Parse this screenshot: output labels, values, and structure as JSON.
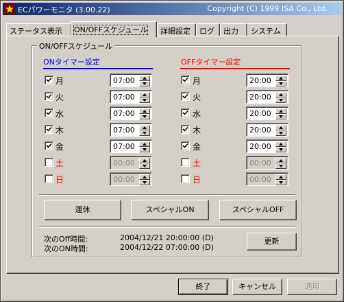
{
  "window": {
    "title": "ECパワーモニタ (3.00.22)",
    "copyright": "Copyright (C) 1999 ISA Co., Ltd."
  },
  "tabs": [
    {
      "label": "ステータス表示"
    },
    {
      "label": "ON/OFFスケジュール"
    },
    {
      "label": "詳細設定"
    },
    {
      "label": "ログ"
    },
    {
      "label": "出力"
    },
    {
      "label": "システム"
    }
  ],
  "schedule": {
    "group_title": "ON/OFFスケジュール",
    "on_header": "ONタイマー設定",
    "off_header": "OFFタイマー設定",
    "days": [
      {
        "day": "月",
        "on_checked": true,
        "on_time": "07:00",
        "off_checked": true,
        "off_time": "20:00",
        "weekend": false
      },
      {
        "day": "火",
        "on_checked": true,
        "on_time": "07:00",
        "off_checked": true,
        "off_time": "20:00",
        "weekend": false
      },
      {
        "day": "水",
        "on_checked": true,
        "on_time": "07:00",
        "off_checked": true,
        "off_time": "20:00",
        "weekend": false
      },
      {
        "day": "木",
        "on_checked": true,
        "on_time": "07:00",
        "off_checked": true,
        "off_time": "20:00",
        "weekend": false
      },
      {
        "day": "金",
        "on_checked": true,
        "on_time": "07:00",
        "off_checked": true,
        "off_time": "20:00",
        "weekend": false
      },
      {
        "day": "土",
        "on_checked": false,
        "on_time": "00:00",
        "off_checked": false,
        "off_time": "00:00",
        "weekend": true
      },
      {
        "day": "日",
        "on_checked": false,
        "on_time": "00:00",
        "off_checked": false,
        "off_time": "00:00",
        "weekend": true
      }
    ],
    "buttons": {
      "holiday": "運休",
      "special_on": "スペシャルON",
      "special_off": "スペシャルOFF",
      "refresh": "更新"
    },
    "next_off_label": "次のOff時間:",
    "next_off_value": "2004/12/21 20:00:00 (D)",
    "next_on_label": "次のON時間:",
    "next_on_value": "2004/12/22 07:00:00 (D)"
  },
  "footer": {
    "exit": "終了",
    "cancel": "キャンセル",
    "apply": "適用"
  },
  "colors": {
    "on_accent": "#0000ff",
    "off_accent": "#ff0000",
    "titlebar": "#0a246a"
  }
}
